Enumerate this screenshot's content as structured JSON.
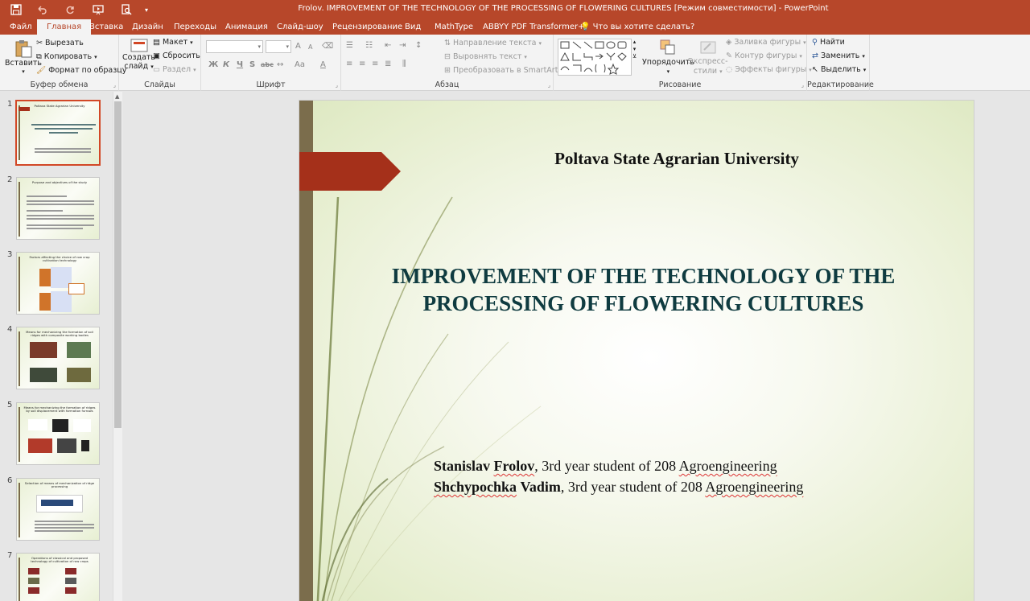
{
  "window": {
    "title": "Frolov. IMPROVEMENT OF THE TECHNOLOGY OF THE PROCESSING OF FLOWERING CULTURES [Режим совместимости] - PowerPoint"
  },
  "tabs": [
    {
      "label": "Файл"
    },
    {
      "label": "Главная",
      "active": true
    },
    {
      "label": "Вставка"
    },
    {
      "label": "Дизайн"
    },
    {
      "label": "Переходы"
    },
    {
      "label": "Анимация"
    },
    {
      "label": "Слайд-шоу"
    },
    {
      "label": "Рецензирование"
    },
    {
      "label": "Вид"
    },
    {
      "label": "MathType"
    },
    {
      "label": "ABBYY PDF Transformer+"
    },
    {
      "label": "Что вы хотите сделать?"
    }
  ],
  "ribbon": {
    "clipboard": {
      "label": "Буфер обмена",
      "paste": "Вставить",
      "cut": "Вырезать",
      "copy": "Копировать",
      "format_painter": "Формат по образцу"
    },
    "slides": {
      "label": "Слайды",
      "new_slide_1": "Создать",
      "new_slide_2": "слайд",
      "layout": "Макет",
      "reset": "Сбросить",
      "section": "Раздел"
    },
    "font": {
      "label": "Шрифт",
      "bold": "Ж",
      "italic": "К",
      "underline": "Ч",
      "shadow": "S",
      "strike": "abc",
      "grow": "A",
      "shrink": "A",
      "case": "Aa",
      "color": "A"
    },
    "paragraph": {
      "label": "Абзац",
      "text_direction": "Направление текста",
      "align_text": "Выровнять текст",
      "smartart": "Преобразовать в SmartArt"
    },
    "drawing": {
      "label": "Рисование",
      "arrange": "Упорядочить",
      "quick_styles_1": "Экспресс-",
      "quick_styles_2": "стили",
      "shape_fill": "Заливка фигуры",
      "shape_outline": "Контур фигуры",
      "shape_effects": "Эффекты фигуры"
    },
    "editing": {
      "label": "Редактирование",
      "find": "Найти",
      "replace": "Заменить",
      "select": "Выделить"
    }
  },
  "thumbnails": [
    {
      "num": "1",
      "title": "Poltava State Agrarian University",
      "selected": true
    },
    {
      "num": "2",
      "title": "Purpose and objectives of the study"
    },
    {
      "num": "3",
      "title": "Factors affecting the choice of row crop cultivation technology"
    },
    {
      "num": "4",
      "title": "Means for mechanizing the formation of soil ridges with composite working bodies"
    },
    {
      "num": "5",
      "title": "Means for mechanizing the formation of ridges by soil displacement with formation furrows"
    },
    {
      "num": "6",
      "title": "Selection of means of mechanization of ridge processing"
    },
    {
      "num": "7",
      "title": "Operations of classical and proposed technology of cultivation of row crops"
    }
  ],
  "slide": {
    "university": "Poltava State Agrarian University",
    "title": "IMPROVEMENT OF THE TECHNOLOGY OF THE PROCESSING OF FLOWERING CULTURES",
    "author1_first": "Stanislav",
    "author1_last": "Frolov",
    "author1_rest_a": ", 3rd year student of 208 ",
    "author1_rest_b": "Agroengineering",
    "author2_first": "Shchypochka",
    "author2_last": "Vadim",
    "author2_rest_a": ", 3rd year student of 208 ",
    "author2_rest_b": "Agroengineering"
  },
  "colors": {
    "accent": "#b7472a",
    "title_text": "#0f3b40",
    "slide_bar": "#7b6d4c",
    "slide_arrow": "#a5301a"
  }
}
